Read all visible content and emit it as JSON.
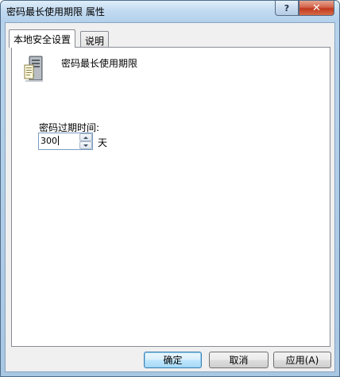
{
  "window": {
    "title": "密码最长使用期限 属性",
    "help_label": "?",
    "close_label": "✕"
  },
  "tabs": [
    {
      "label": "本地安全设置",
      "active": true
    },
    {
      "label": "说明",
      "active": false
    }
  ],
  "panel": {
    "icon": "server-policy-icon",
    "policy_name": "密码最长使用期限",
    "field_label": "密码过期时间:",
    "value": "300",
    "unit": "天"
  },
  "buttons": {
    "ok": "确定",
    "cancel": "取消",
    "apply": "应用(A)"
  }
}
